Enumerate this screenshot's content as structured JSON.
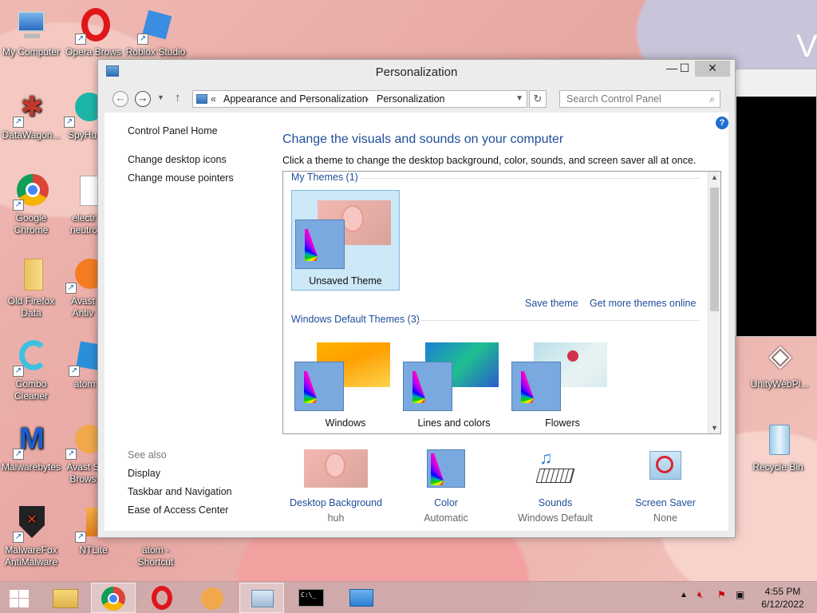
{
  "desktop": {
    "icons": [
      {
        "label": "My Computer"
      },
      {
        "label": "Opera Brows"
      },
      {
        "label": "Roblox Studio"
      },
      {
        "label": "DataWagon..."
      },
      {
        "label": "SpyHu"
      },
      {
        "label": "Google Chrome"
      },
      {
        "label": "electr neutro"
      },
      {
        "label": "Old Firefox Data"
      },
      {
        "label": "Avast Antiv"
      },
      {
        "label": "Combo Cleaner"
      },
      {
        "label": "atom"
      },
      {
        "label": "Malwarebytes"
      },
      {
        "label": "Avast S Brows"
      },
      {
        "label": "MalwareFox AntiMalware"
      },
      {
        "label": "NTLite"
      },
      {
        "label": "atom - Shortcut"
      },
      {
        "label": "UnityWebPl..."
      },
      {
        "label": "Recycle Bin"
      }
    ],
    "bg_window_text": "V"
  },
  "window": {
    "title": "Personalization",
    "controls": {
      "minimize": "—",
      "maximize": "☐",
      "close": "✕"
    }
  },
  "navbar": {
    "back": "←",
    "forward": "→",
    "up": "↑",
    "address": {
      "prefix": "«",
      "segment1": "Appearance and Personalization",
      "separator": "›",
      "segment2": "Personalization"
    },
    "search_placeholder": "Search Control Panel"
  },
  "left_nav": {
    "home": "Control Panel Home",
    "links": [
      "Change desktop icons",
      "Change mouse pointers"
    ],
    "see_also_label": "See also",
    "see_also": [
      "Display",
      "Taskbar and Navigation",
      "Ease of Access Center"
    ]
  },
  "main": {
    "title": "Change the visuals and sounds on your computer",
    "description": "Click a theme to change the desktop background, color, sounds, and screen saver all at once.",
    "my_themes_label": "My Themes (1)",
    "my_themes": [
      {
        "label": "Unsaved Theme"
      }
    ],
    "save_theme": "Save theme",
    "get_more_themes": "Get more themes online",
    "default_themes_label": "Windows Default Themes (3)",
    "default_themes": [
      {
        "label": "Windows"
      },
      {
        "label": "Lines and colors"
      },
      {
        "label": "Flowers"
      }
    ]
  },
  "bottom": [
    {
      "title": "Desktop Background",
      "subtitle": "huh"
    },
    {
      "title": "Color",
      "subtitle": "Automatic"
    },
    {
      "title": "Sounds",
      "subtitle": "Windows Default"
    },
    {
      "title": "Screen Saver",
      "subtitle": "None"
    }
  ],
  "taskbar": {
    "time": "4:55 PM",
    "date": "6/12/2022",
    "cmd_text": "C:\\_"
  },
  "colors": {
    "accent_link": "#1f4e99",
    "selected_tile": "#cde8f7",
    "taskbar": "#cdaaaa"
  }
}
